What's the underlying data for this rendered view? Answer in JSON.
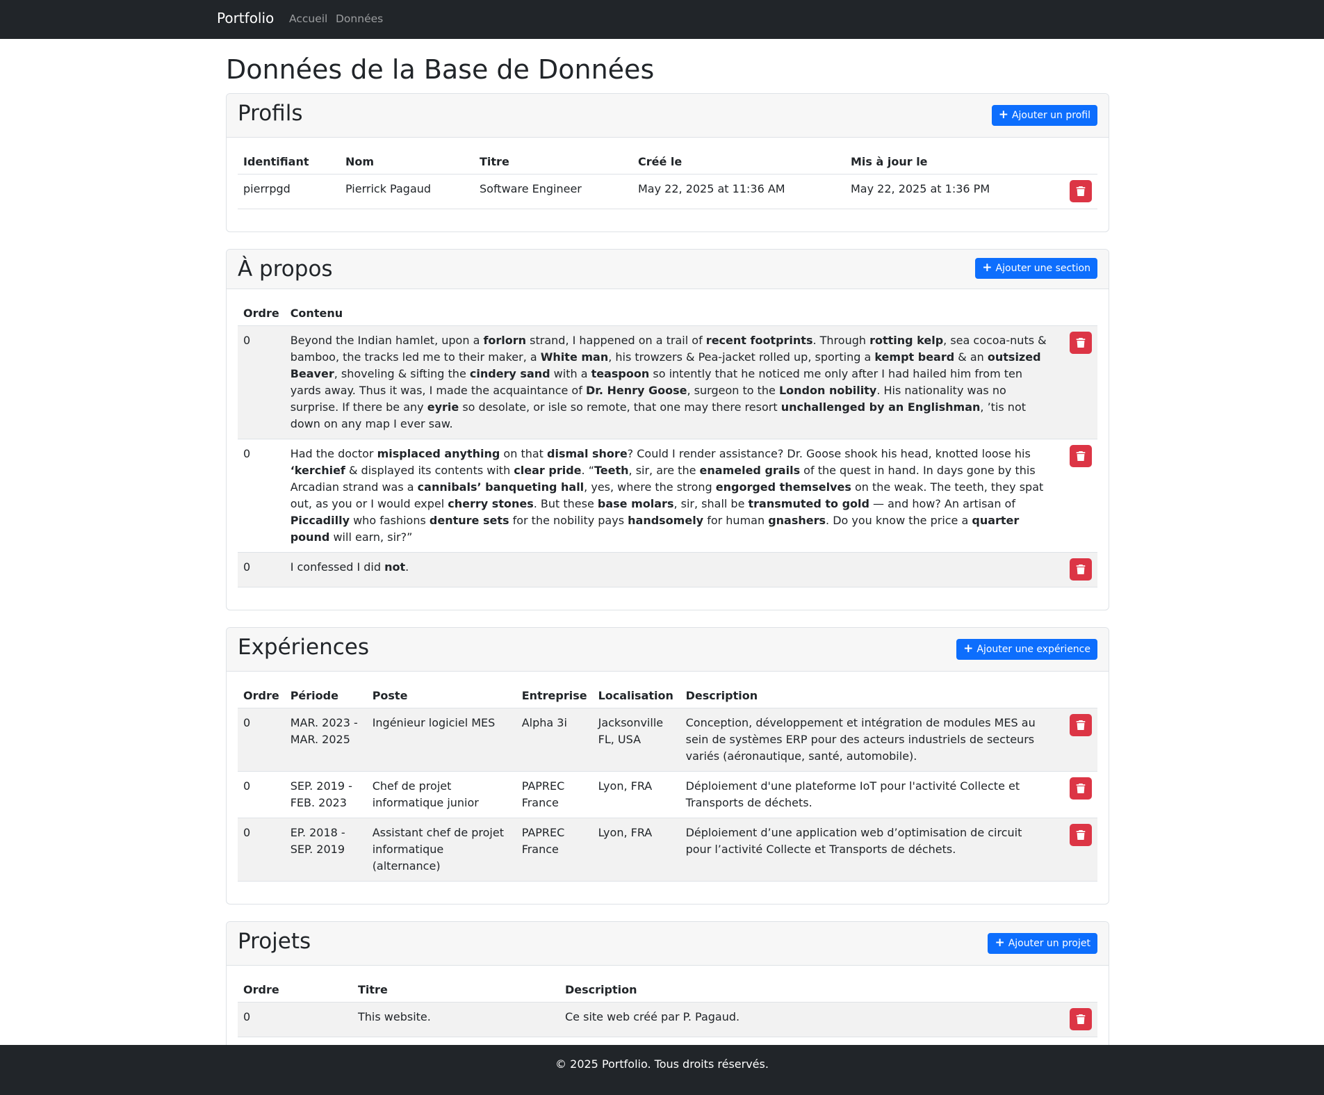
{
  "nav": {
    "brand": "Portfolio",
    "links": [
      "Accueil",
      "Données"
    ]
  },
  "page": {
    "title": "Données de la Base de Données"
  },
  "profils": {
    "title": "Profils",
    "add_label": "Ajouter un profil",
    "headers": [
      "Identifiant",
      "Nom",
      "Titre",
      "Créé le",
      "Mis à jour le"
    ],
    "rows": [
      [
        "pierrpgd",
        "Pierrick Pagaud",
        "Software Engineer",
        "May 22, 2025 at 11:36 AM",
        "May 22, 2025 at 1:36 PM"
      ]
    ]
  },
  "apropos": {
    "title": "À propos",
    "add_label": "Ajouter une section",
    "headers": [
      "Ordre",
      "Contenu"
    ],
    "rows": [
      {
        "ordre": "0",
        "segments": [
          {
            "t": "Beyond the Indian hamlet, upon a "
          },
          {
            "t": "forlorn",
            "b": true
          },
          {
            "t": " strand, I happened on a trail of "
          },
          {
            "t": "recent footprints",
            "b": true
          },
          {
            "t": ". Through "
          },
          {
            "t": "rotting kelp",
            "b": true
          },
          {
            "t": ", sea cocoa-nuts & bamboo, the tracks led me to their maker, a "
          },
          {
            "t": "White man",
            "b": true
          },
          {
            "t": ", his trowzers & Pea-jacket rolled up, sporting a "
          },
          {
            "t": "kempt beard",
            "b": true
          },
          {
            "t": " & an "
          },
          {
            "t": "outsized Beaver",
            "b": true
          },
          {
            "t": ", shoveling & sifting the "
          },
          {
            "t": "cindery sand",
            "b": true
          },
          {
            "t": " with a "
          },
          {
            "t": "teaspoon",
            "b": true
          },
          {
            "t": " so intently that he noticed me only after I had hailed him from ten yards away. Thus it was, I made the acquaintance of "
          },
          {
            "t": "Dr. Henry Goose",
            "b": true
          },
          {
            "t": ", surgeon to the "
          },
          {
            "t": "London nobility",
            "b": true
          },
          {
            "t": ". His nationality was no surprise. If there be any "
          },
          {
            "t": "eyrie",
            "b": true
          },
          {
            "t": " so desolate, or isle so remote, that one may there resort "
          },
          {
            "t": "unchallenged by an Englishman",
            "b": true
          },
          {
            "t": ", ’tis not down on any map I ever saw."
          }
        ]
      },
      {
        "ordre": "0",
        "segments": [
          {
            "t": "Had the doctor "
          },
          {
            "t": "misplaced anything",
            "b": true
          },
          {
            "t": " on that "
          },
          {
            "t": "dismal shore",
            "b": true
          },
          {
            "t": "? Could I render assistance? Dr. Goose shook his head, knotted loose his "
          },
          {
            "t": "‘kerchief",
            "b": true
          },
          {
            "t": " & displayed its contents with "
          },
          {
            "t": "clear pride",
            "b": true
          },
          {
            "t": ". “"
          },
          {
            "t": "Teeth",
            "b": true
          },
          {
            "t": ", sir, are the "
          },
          {
            "t": "enameled grails",
            "b": true
          },
          {
            "t": " of the quest in hand. In days gone by this Arcadian strand was a "
          },
          {
            "t": "cannibals’ banqueting hall",
            "b": true
          },
          {
            "t": ", yes, where the strong "
          },
          {
            "t": "engorged themselves",
            "b": true
          },
          {
            "t": " on the weak. The teeth, they spat out, as you or I would expel "
          },
          {
            "t": "cherry stones",
            "b": true
          },
          {
            "t": ". But these "
          },
          {
            "t": "base molars",
            "b": true
          },
          {
            "t": ", sir, shall be "
          },
          {
            "t": "transmuted to gold",
            "b": true
          },
          {
            "t": " — and how? An artisan of "
          },
          {
            "t": "Piccadilly",
            "b": true
          },
          {
            "t": " who fashions "
          },
          {
            "t": "denture sets",
            "b": true
          },
          {
            "t": " for the nobility pays "
          },
          {
            "t": "handsomely",
            "b": true
          },
          {
            "t": " for human "
          },
          {
            "t": "gnashers",
            "b": true
          },
          {
            "t": ". Do you know the price a "
          },
          {
            "t": "quarter pound",
            "b": true
          },
          {
            "t": " will earn, sir?”"
          }
        ]
      },
      {
        "ordre": "0",
        "segments": [
          {
            "t": "I confessed I did "
          },
          {
            "t": "not",
            "b": true
          },
          {
            "t": "."
          }
        ]
      }
    ]
  },
  "experiences": {
    "title": "Expériences",
    "add_label": "Ajouter une expérience",
    "headers": [
      "Ordre",
      "Période",
      "Poste",
      "Entreprise",
      "Localisation",
      "Description"
    ],
    "rows": [
      [
        "0",
        "MAR. 2023 - MAR. 2025",
        "Ingénieur logiciel MES",
        "Alpha 3i",
        "Jacksonville FL, USA",
        "Conception, développement et intégration de modules MES au sein de systèmes ERP pour des acteurs industriels de secteurs variés (aéronautique, santé, automobile)."
      ],
      [
        "0",
        "SEP. 2019 - FEB. 2023",
        "Chef de projet informatique junior",
        "PAPREC France",
        "Lyon, FRA",
        "Déploiement d'une plateforme IoT pour l'activité Collecte et Transports de déchets."
      ],
      [
        "0",
        "EP. 2018 - SEP. 2019",
        "Assistant chef de projet informatique (alternance)",
        "PAPREC France",
        "Lyon, FRA",
        "Déploiement d’une application web d’optimisation de circuit pour l’activité Collecte et Transports de déchets."
      ]
    ]
  },
  "projets": {
    "title": "Projets",
    "add_label": "Ajouter un projet",
    "headers": [
      "Ordre",
      "Titre",
      "Description"
    ],
    "rows": [
      [
        "0",
        "This website.",
        "Ce site web créé par P. Pagaud."
      ]
    ]
  },
  "footer": {
    "text": "© 2025 Portfolio. Tous droits réservés."
  },
  "colors": {
    "primary": "#0d6efd",
    "danger": "#dc3545",
    "navbar": "#212529",
    "stripe": "#f2f2f2"
  },
  "icons": {
    "add": "plus-icon",
    "delete": "trash-icon"
  }
}
